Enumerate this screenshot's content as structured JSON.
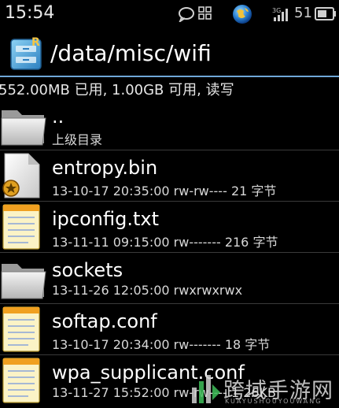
{
  "status_bar": {
    "time": "15:54",
    "battery_level": "51",
    "icons": [
      "chat-bubble-icon",
      "grid-icon",
      "globe-icon",
      "signal-icon",
      "battery-icon"
    ]
  },
  "title_bar": {
    "path": "/data/misc/wifi",
    "icon": "file-manager-app-icon"
  },
  "storage_info": "552.00MB 已用, 1.00GB 可用, 读写",
  "files": [
    {
      "name": "..",
      "meta": "上级目录",
      "icon": "folder-icon"
    },
    {
      "name": "entropy.bin",
      "meta": "13-10-17 20:35:00  rw-rw----  21 字节",
      "icon": "binary-file-icon"
    },
    {
      "name": "ipconfig.txt",
      "meta": "13-11-11 09:15:00  rw-------  216 字节",
      "icon": "text-file-icon"
    },
    {
      "name": "sockets",
      "meta": "13-11-26 12:05:00  rwxrwxrwx",
      "icon": "folder-icon"
    },
    {
      "name": "softap.conf",
      "meta": "13-10-17 20:34:00  rw-------  18 字节",
      "icon": "text-file-icon"
    },
    {
      "name": "wpa_supplicant.conf",
      "meta": "13-11-27 15:52:00  rw-rw----  1.26KB",
      "icon": "text-file-icon"
    }
  ],
  "watermark": {
    "text": "跨域手游网",
    "subtext": "KUAYUSHOUYOUWANG"
  }
}
